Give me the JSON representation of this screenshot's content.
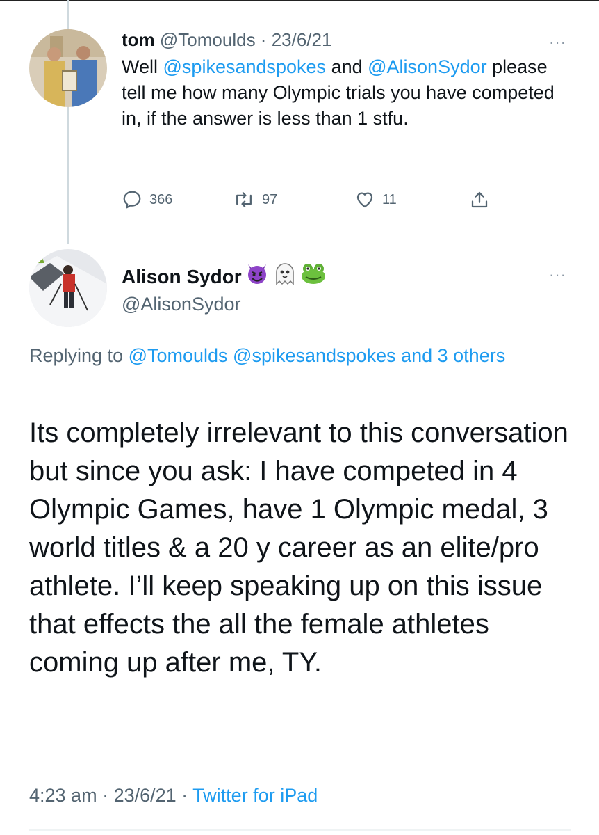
{
  "tweet1": {
    "display_name": "tom",
    "handle": "@Tomoulds",
    "sep": " · ",
    "date": "23/6/21",
    "more": "···",
    "body": {
      "w1": "Well ",
      "mention1": "@spikesandspokes",
      "w2": " and ",
      "mention2": "@AlisonSydor",
      "w3": " please tell me how many Olympic trials you have competed in, if the answer is less than 1 stfu."
    },
    "actions": {
      "replies": "366",
      "retweets": "97",
      "likes": "11"
    }
  },
  "tweet2": {
    "display_name": "Alison Sydor",
    "emojis": [
      "devil-emoji",
      "ghost-emoji",
      "frog-emoji"
    ],
    "handle": "@AlisonSydor",
    "more": "···",
    "replying": {
      "prefix": "Replying to ",
      "mentions": "@Tomoulds @spikesandspokes and 3 others"
    },
    "body": "Its completely irrelevant to this conversation but since you ask: I have competed in 4 Olympic Games, have 1 Olympic medal, 3 world titles & a 20 y career as an elite/pro athlete. I’ll keep speaking up on this issue that effects the all the female athletes coming up after me, TY.",
    "time": "4:23 am",
    "date": "23/6/21",
    "sep": " · ",
    "source": "Twitter for iPad"
  },
  "colors": {
    "link": "#1d9bf0",
    "secondary_text": "#536471",
    "primary_text": "#0f1419",
    "thread_line": "#cfd9de"
  }
}
